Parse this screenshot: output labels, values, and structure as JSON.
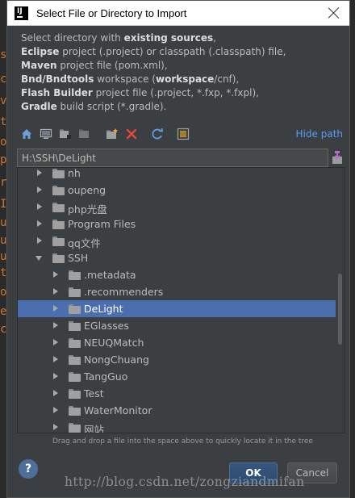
{
  "background_editor": {
    "glyphs": [
      "s",
      "c",
      "v",
      "t",
      "o",
      "p",
      "r",
      "I",
      "u",
      "u",
      "u",
      "t",
      "o",
      "e",
      "c"
    ]
  },
  "dialog": {
    "title": "Select File or Directory to Import",
    "description": {
      "intro_plain": "Select directory with ",
      "intro_bold": "existing sources",
      "intro_tail": ",",
      "lines": [
        {
          "bold": "Eclipse",
          "rest": " project (.project) or classpath (.classpath) file,"
        },
        {
          "bold": "Maven",
          "rest": " project file (pom.xml),"
        },
        {
          "bold": "Bnd/Bndtools",
          "rest": " workspace (",
          "bold2": "workspace",
          "rest2": "/cnf),"
        },
        {
          "bold": "Flash Builder",
          "rest": " project file (.project, *.fxp, *.fxpl),"
        },
        {
          "bold": "Gradle",
          "rest": " build script (*.gradle)."
        }
      ]
    },
    "toolbar": {
      "icons": [
        "home-icon",
        "desktop-icon",
        "project-icon",
        "module-icon",
        "new-folder-icon",
        "delete-icon",
        "refresh-icon",
        "show-hidden-icon"
      ],
      "hide_path_label": "Hide path"
    },
    "path_value": "H:\\SSH\\DeLight",
    "tree": [
      {
        "label": "nh",
        "level": 0,
        "expanded": false
      },
      {
        "label": "oupeng",
        "level": 0,
        "expanded": false
      },
      {
        "label": "php光盘",
        "level": 0,
        "expanded": false
      },
      {
        "label": "Program Files",
        "level": 0,
        "expanded": false
      },
      {
        "label": "qq文件",
        "level": 0,
        "expanded": false
      },
      {
        "label": "SSH",
        "level": 0,
        "expanded": true
      },
      {
        "label": ".metadata",
        "level": 1,
        "expanded": false
      },
      {
        "label": ".recommenders",
        "level": 1,
        "expanded": false
      },
      {
        "label": "DeLight",
        "level": 1,
        "expanded": false,
        "selected": true
      },
      {
        "label": "EGlasses",
        "level": 1,
        "expanded": false
      },
      {
        "label": "NEUQMatch",
        "level": 1,
        "expanded": false
      },
      {
        "label": "NongChuang",
        "level": 1,
        "expanded": false
      },
      {
        "label": "TangGuo",
        "level": 1,
        "expanded": false
      },
      {
        "label": "Test",
        "level": 1,
        "expanded": false
      },
      {
        "label": "WaterMonitor",
        "level": 1,
        "expanded": false
      },
      {
        "label": "网站",
        "level": 1,
        "expanded": false
      }
    ],
    "hint": "Drag and drop a file into the space above to quickly locate it in the tree",
    "help_label": "?",
    "ok_label": "OK",
    "cancel_label": "Cancel"
  },
  "watermark": "http://blog.csdn.net/zongziandmifan",
  "colors": {
    "dialog_bg": "#3c3f41",
    "selection": "#4b6eaf",
    "link": "#589df6",
    "text": "#bbbbbb"
  }
}
